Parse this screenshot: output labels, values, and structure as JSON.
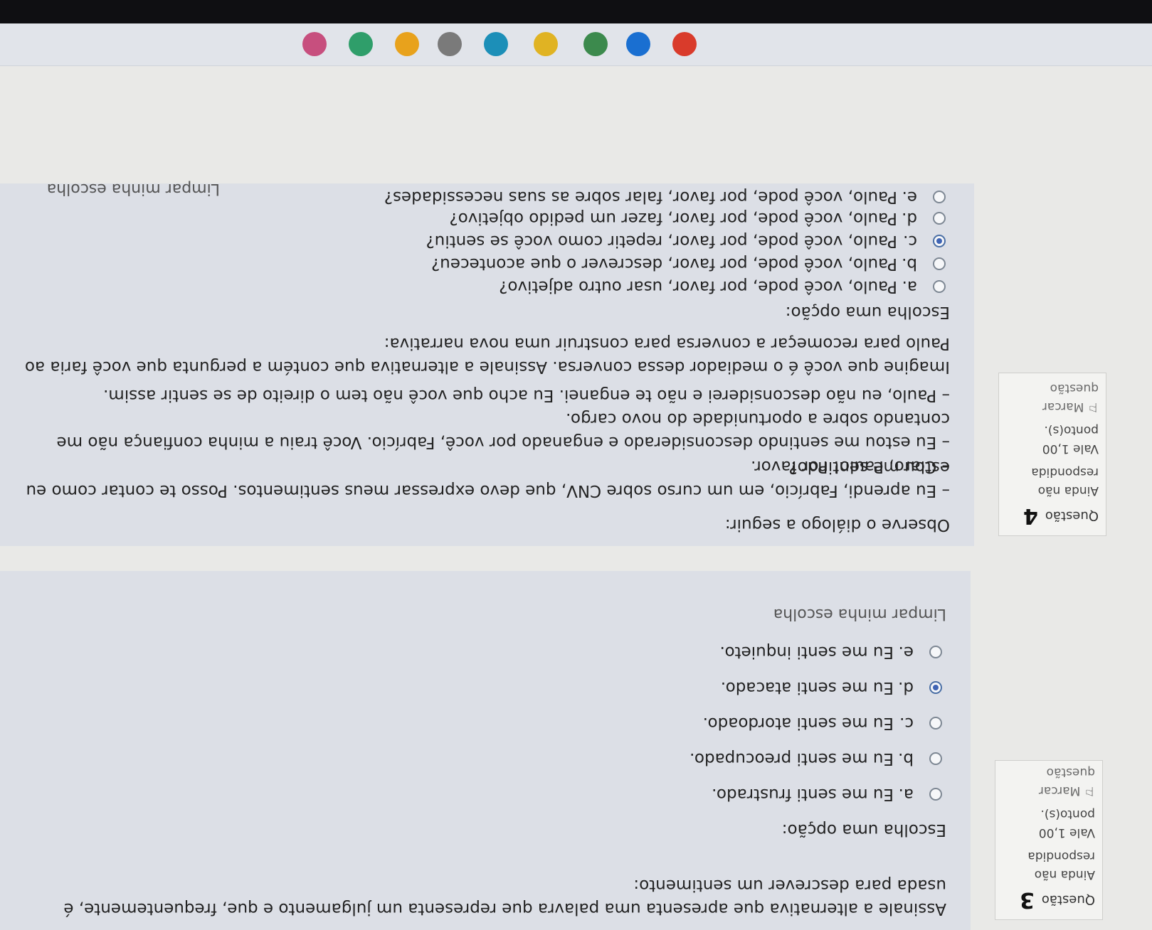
{
  "q3": {
    "question_label": "Questão",
    "number": "3",
    "status": "Ainda não respondida",
    "value": "Vale 1,00 ponto(s).",
    "flag": "Marcar questão",
    "prompt": "Assinale a alternativa que apresenta uma palavra que representa um julgamento e que, frequentemente, é usada para descrever um sentimento:",
    "choose": "Escolha uma opção:",
    "options": [
      {
        "letter": "a.",
        "text": "Eu me senti frustrado."
      },
      {
        "letter": "b.",
        "text": "Eu me senti preocupado."
      },
      {
        "letter": "c.",
        "text": "Eu me senti atordoado."
      },
      {
        "letter": "d.",
        "text": "Eu me senti atacado."
      },
      {
        "letter": "e.",
        "text": "Eu me senti inquieto."
      }
    ],
    "selected": "d.",
    "clear": "Limpar minha escolha"
  },
  "q4": {
    "question_label": "Questão",
    "number": "4",
    "status": "Ainda não respondida",
    "value": "Vale 1,00 ponto(s).",
    "flag": "Marcar questão",
    "intro": "Observe o diálogo a seguir:",
    "dialogue": [
      "– Eu aprendi, Fabrício, em um curso sobre CNV, que devo expressar meus sentimentos. Posso te contar como eu estou me sentindo?",
      "– Claro, Paulo! Por favor.",
      "– Eu estou me sentindo desconsiderado e enganado por você, Fabrício. Você traiu a minha confiança não me contando sobre a oportunidade do novo cargo.",
      "– Paulo, eu não desconsiderei e não te enganei. Eu acho que você não tem o direito de se sentir assim."
    ],
    "task": "Imagine que você é o mediador dessa conversa. Assinale a alternativa que contém a pergunta que você faria ao Paulo para recomeçar a conversa para construir uma nova narrativa:",
    "choose": "Escolha uma opção:",
    "options": [
      {
        "letter": "a.",
        "text": "Paulo, você pode, por favor, usar outro adjetivo?"
      },
      {
        "letter": "b.",
        "text": "Paulo, você pode, por favor, descrever o que aconteceu?"
      },
      {
        "letter": "c.",
        "text": "Paulo, você pode, por favor, repetir como você se sentiu?"
      },
      {
        "letter": "d.",
        "text": "Paulo, você pode, por favor, fazer um pedido objetivo?"
      },
      {
        "letter": "e.",
        "text": "Paulo, você pode, por favor, falar sobre as suas necessidades?"
      }
    ],
    "selected": "c.",
    "clear": "Limpar minha escolha"
  },
  "taskbar": {
    "icons": [
      {
        "name": "chrome-icon",
        "color": "#d93b2b"
      },
      {
        "name": "outlook-icon",
        "color": "#1a6fd1"
      },
      {
        "name": "app-icon",
        "color": "#3c8a4d"
      },
      {
        "name": "file-explorer-icon",
        "color": "#e0b323"
      },
      {
        "name": "edge-icon",
        "color": "#1c8fb8"
      },
      {
        "name": "copilot-icon",
        "color": "#7a7a7a"
      },
      {
        "name": "chrome-alt-icon",
        "color": "#e8a21c"
      },
      {
        "name": "edge-alt-icon",
        "color": "#2f9e6a"
      },
      {
        "name": "widgets-icon",
        "color": "#c74f7e"
      }
    ]
  }
}
